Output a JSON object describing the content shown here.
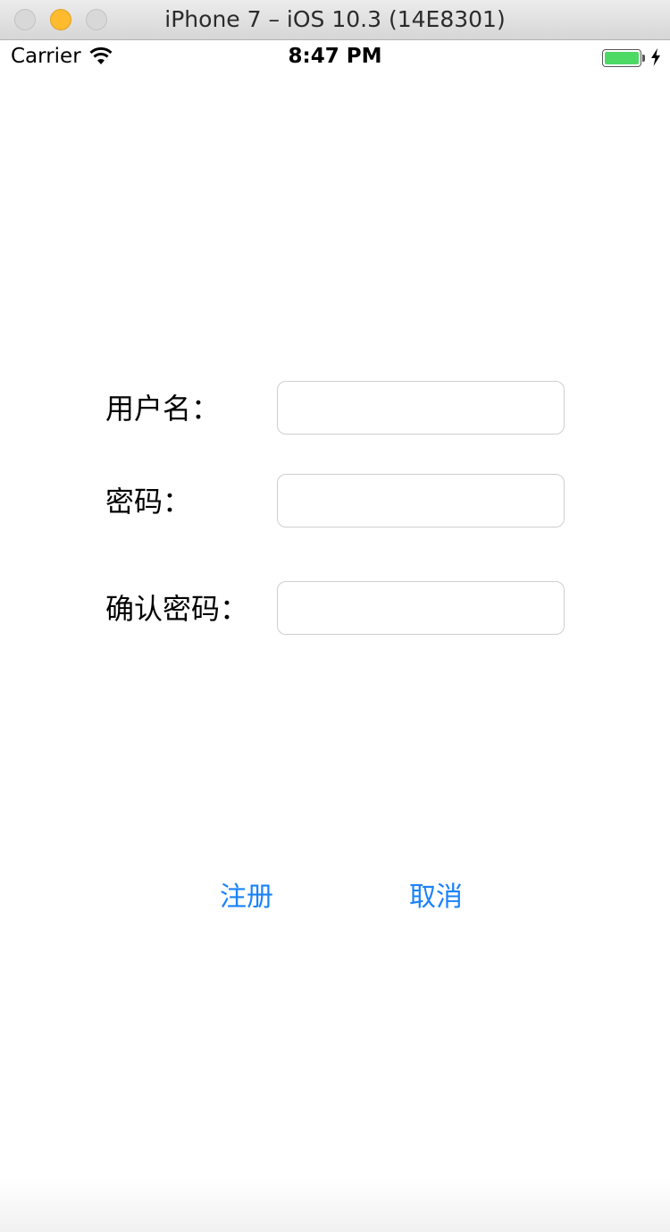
{
  "window": {
    "title": "iPhone 7 – iOS 10.3 (14E8301)"
  },
  "status_bar": {
    "carrier": "Carrier",
    "time": "8:47 PM",
    "wifi_icon": "wifi-icon",
    "battery_icon": "battery-icon",
    "battery_level": 1.0,
    "charging_icon": "charging-bolt-icon"
  },
  "form": {
    "username": {
      "label": "用户名：",
      "value": "",
      "placeholder": ""
    },
    "password": {
      "label": "密码：",
      "value": "",
      "placeholder": ""
    },
    "confirm_password": {
      "label": "确认密码：",
      "value": "",
      "placeholder": ""
    }
  },
  "actions": {
    "register_label": "注册",
    "cancel_label": "取消"
  },
  "colors": {
    "accent": "#1a82fb",
    "battery": "#4cd964",
    "minimize_button": "#febb2e"
  }
}
